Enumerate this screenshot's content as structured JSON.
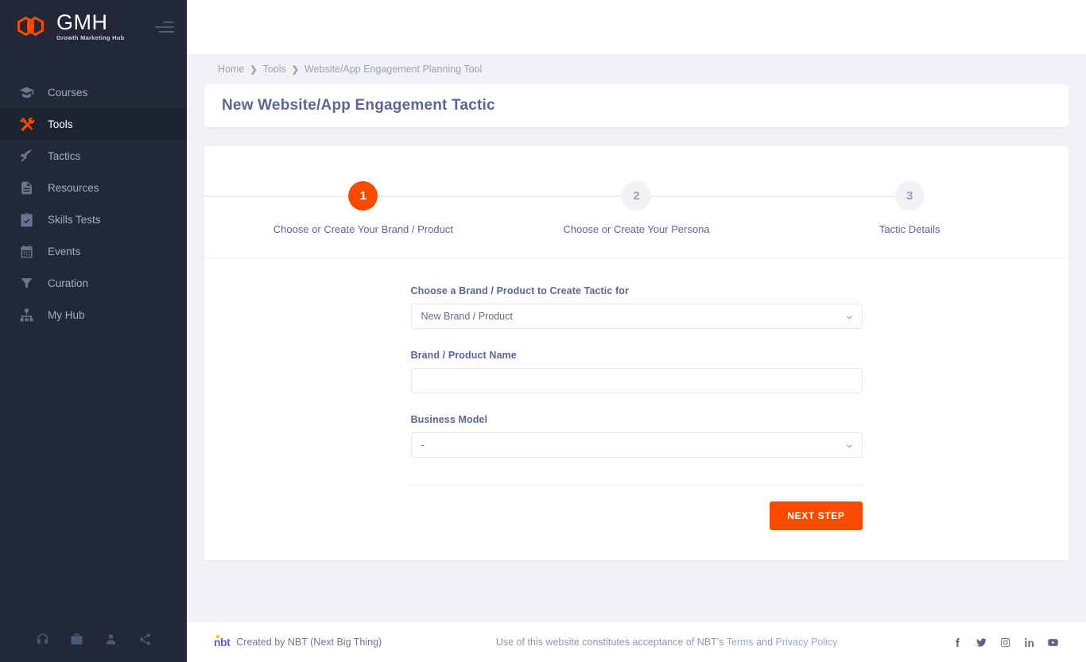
{
  "brand": {
    "title": "GMH",
    "subtitle": "Growth Marketing Hub",
    "logo_icon": "hexagon-pair-icon",
    "menu_icon": "hamburger-menu-icon",
    "accent_color": "#f94b00",
    "sidebar_bg": "#232838"
  },
  "sidebar": {
    "items": [
      {
        "label": "Courses",
        "icon": "graduation-cap-icon",
        "active": false
      },
      {
        "label": "Tools",
        "icon": "tools-icon",
        "active": true
      },
      {
        "label": "Tactics",
        "icon": "rocket-icon",
        "active": false
      },
      {
        "label": "Resources",
        "icon": "file-text-icon",
        "active": false
      },
      {
        "label": "Skills Tests",
        "icon": "clipboard-check-icon",
        "active": false
      },
      {
        "label": "Events",
        "icon": "calendar-icon",
        "active": false
      },
      {
        "label": "Curation",
        "icon": "filter-icon",
        "active": false
      },
      {
        "label": "My Hub",
        "icon": "sitemap-icon",
        "active": false
      }
    ],
    "bottom_icons": [
      {
        "name": "headphones-icon"
      },
      {
        "name": "briefcase-icon"
      },
      {
        "name": "user-icon"
      },
      {
        "name": "share-icon"
      }
    ]
  },
  "breadcrumb": {
    "items": [
      "Home",
      "Tools",
      "Website/App Engagement Planning Tool"
    ],
    "separator": "❯"
  },
  "page": {
    "title": "New Website/App Engagement Tactic"
  },
  "stepper": {
    "steps": [
      {
        "number": "1",
        "label": "Choose or Create Your Brand / Product",
        "active": true
      },
      {
        "number": "2",
        "label": "Choose or Create Your Persona",
        "active": false
      },
      {
        "number": "3",
        "label": "Tactic Details",
        "active": false
      }
    ]
  },
  "form": {
    "brand_select": {
      "label": "Choose a Brand / Product to Create Tactic for",
      "value": "New Brand / Product",
      "chevron_icon": "chevron-down-icon"
    },
    "brand_name": {
      "label": "Brand / Product Name",
      "value": "",
      "placeholder": ""
    },
    "business_model": {
      "label": "Business Model",
      "value": "-",
      "chevron_icon": "chevron-down-icon"
    },
    "next_button": "NEXT STEP"
  },
  "footer": {
    "nbt_mark": "nbt",
    "created_by": "Created by  NBT (Next Big Thing)",
    "legal_prefix": "Use of this website constitutes acceptance of NBT's ",
    "terms_link": "Terms",
    "legal_mid": " and ",
    "privacy_link": "Privacy Policy",
    "social": [
      {
        "name": "facebook-icon"
      },
      {
        "name": "twitter-icon"
      },
      {
        "name": "instagram-icon"
      },
      {
        "name": "linkedin-icon"
      },
      {
        "name": "youtube-icon"
      }
    ]
  }
}
